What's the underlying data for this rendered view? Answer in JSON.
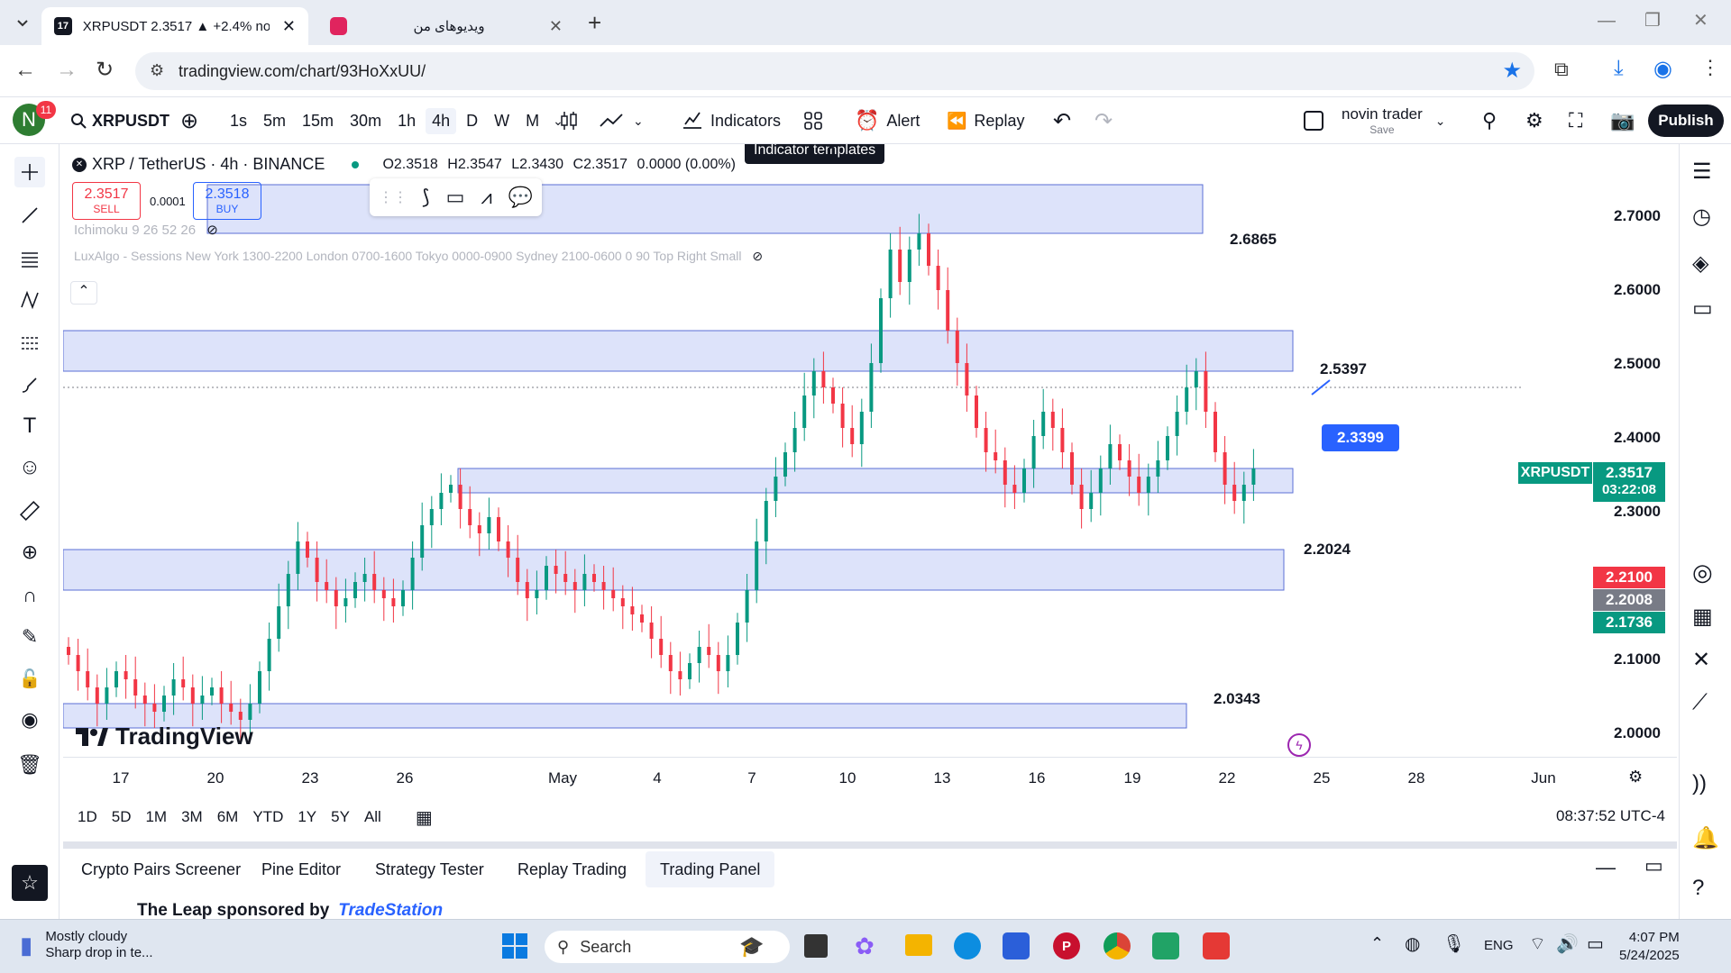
{
  "browser": {
    "tabs": [
      {
        "label": "XRPUSDT 2.3517 ▲ +2.4% novi",
        "active": true
      },
      {
        "label": "ویدیوهای من",
        "active": false
      }
    ],
    "url": "tradingview.com/chart/93HoXxUU/"
  },
  "toolbar": {
    "avatar_letter": "N",
    "notifications": "11",
    "symbol": "XRPUSDT",
    "timeframes": [
      "1s",
      "5m",
      "15m",
      "30m",
      "1h",
      "4h",
      "D",
      "W",
      "M"
    ],
    "selected_timeframe": "4h",
    "indicators_label": "Indicators",
    "alert_label": "Alert",
    "replay_label": "Replay",
    "layout_name": "novin trader",
    "layout_save": "Save",
    "publish_label": "Publish",
    "tooltip": "Indicator templates"
  },
  "legend": {
    "title": "XRP / TetherUS · 4h · BINANCE",
    "ohlc": {
      "o": "O2.3518",
      "h": "H2.3547",
      "l": "L2.3430",
      "c": "C2.3517",
      "chg": "0.0000 (0.00%)"
    },
    "sell_price": "2.3517",
    "sell_label": "SELL",
    "spread": "0.0001",
    "buy_price": "2.3518",
    "buy_label": "BUY",
    "indicator1": "Ichimoku 9 26 52 26",
    "indicator2": "LuxAlgo - Sessions New York 1300-2200 London 0700-1600 Tokyo 0000-0900 Sydney 2100-0600 0 90 Top Right Small"
  },
  "chart_data": {
    "type": "candlestick",
    "symbol": "XRPUSDT",
    "price_axis": [
      "2.7000",
      "2.6000",
      "2.5000",
      "2.4000",
      "2.3000",
      "2.1000",
      "2.0000"
    ],
    "x_labels": [
      "17",
      "20",
      "23",
      "26",
      "May",
      "4",
      "7",
      "10",
      "13",
      "16",
      "19",
      "22",
      "25",
      "28",
      "Jun"
    ],
    "ylim": [
      1.95,
      2.75
    ],
    "zones": [
      {
        "label": "2.6865",
        "low": 2.64,
        "high": 2.7
      },
      {
        "label": "2.5397",
        "low": 2.47,
        "high": 2.52
      },
      {
        "label": "",
        "low": 2.32,
        "high": 2.35
      },
      {
        "label": "2.2024",
        "low": 2.2,
        "high": 2.25
      },
      {
        "label": "2.0343",
        "low": 2.03,
        "high": 2.06
      }
    ],
    "current_label": "XRPUSDT",
    "current_price": "2.3517",
    "countdown": "03:22:08",
    "tag_price": "2.3399",
    "badges": [
      {
        "value": "2.2100",
        "color": "#f23645"
      },
      {
        "value": "2.2008",
        "color": "#787b86"
      },
      {
        "value": "2.1736",
        "color": "#089981"
      }
    ],
    "closes": [
      2.12,
      2.1,
      2.08,
      2.06,
      2.08,
      2.1,
      2.09,
      2.07,
      2.06,
      2.05,
      2.07,
      2.09,
      2.08,
      2.06,
      2.07,
      2.08,
      2.06,
      2.05,
      2.04,
      2.06,
      2.1,
      2.14,
      2.18,
      2.22,
      2.26,
      2.24,
      2.21,
      2.2,
      2.18,
      2.19,
      2.21,
      2.22,
      2.2,
      2.19,
      2.18,
      2.2,
      2.24,
      2.28,
      2.3,
      2.32,
      2.33,
      2.3,
      2.28,
      2.27,
      2.29,
      2.26,
      2.24,
      2.21,
      2.19,
      2.2,
      2.23,
      2.22,
      2.21,
      2.2,
      2.22,
      2.21,
      2.2,
      2.19,
      2.18,
      2.17,
      2.16,
      2.14,
      2.12,
      2.1,
      2.09,
      2.11,
      2.13,
      2.12,
      2.1,
      2.12,
      2.16,
      2.2,
      2.26,
      2.31,
      2.34,
      2.37,
      2.4,
      2.44,
      2.47,
      2.45,
      2.43,
      2.4,
      2.38,
      2.42,
      2.48,
      2.56,
      2.62,
      2.58,
      2.62,
      2.64,
      2.6,
      2.57,
      2.52,
      2.48,
      2.44,
      2.4,
      2.37,
      2.36,
      2.33,
      2.32,
      2.35,
      2.39,
      2.42,
      2.4,
      2.37,
      2.33,
      2.3,
      2.32,
      2.35,
      2.38,
      2.36,
      2.34,
      2.32,
      2.34,
      2.36,
      2.39,
      2.42,
      2.45,
      2.47,
      2.42,
      2.37,
      2.33,
      2.31,
      2.33,
      2.35
    ]
  },
  "footer": {
    "logo_text": "TradingView",
    "ranges": [
      "1D",
      "5D",
      "1M",
      "3M",
      "6M",
      "YTD",
      "1Y",
      "5Y",
      "All"
    ],
    "clock": "08:37:52 UTC-4"
  },
  "panel": {
    "tabs": [
      "Crypto Pairs Screener",
      "Pine Editor",
      "Strategy Tester",
      "Replay Trading",
      "Trading Panel"
    ],
    "selected": "Trading Panel",
    "promo": "The Leap sponsored by",
    "promo_brand": "TradeStation"
  },
  "taskbar": {
    "weather_title": "Mostly cloudy",
    "weather_sub": "Sharp drop in te...",
    "search_placeholder": "Search",
    "lang": "ENG",
    "time": "4:07 PM",
    "date": "5/24/2025"
  }
}
